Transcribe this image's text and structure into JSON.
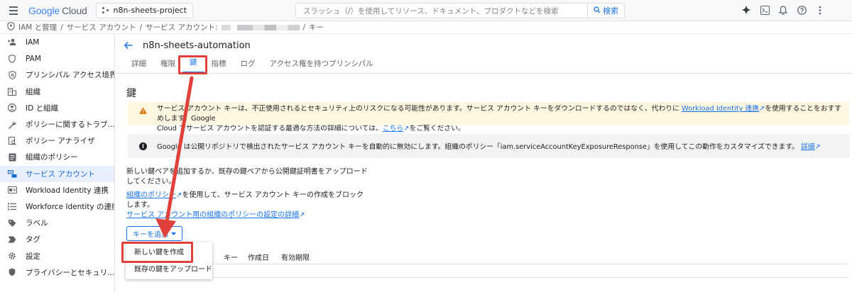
{
  "topbar": {
    "logo_google": "Google",
    "logo_cloud": "Cloud",
    "project": "n8n-sheets-project",
    "search_placeholder": "スラッシュ（/）を使用してリソース、ドキュメント、プロダクトなどを検索",
    "search_button": "検索"
  },
  "breadcrumb": {
    "items": [
      "IAM と管理",
      "サービス アカウント",
      "サービス アカウント:",
      "キー"
    ]
  },
  "sidebar": {
    "items": [
      {
        "label": "IAM",
        "icon": "person-add-icon"
      },
      {
        "label": "PAM",
        "icon": "shield-icon"
      },
      {
        "label": "プリンシパル アクセス境界",
        "icon": "policy-icon"
      },
      {
        "label": "組織",
        "icon": "building-icon"
      },
      {
        "label": "ID と組織",
        "icon": "account-icon"
      },
      {
        "label": "ポリシーに関するトラブ...",
        "icon": "wrench-icon"
      },
      {
        "label": "ポリシー アナライザ",
        "icon": "analyzer-icon"
      },
      {
        "label": "組織のポリシー",
        "icon": "document-icon"
      },
      {
        "label": "サービス アカウント",
        "icon": "service-account-icon"
      },
      {
        "label": "Workload Identity 連携",
        "icon": "id-card-icon"
      },
      {
        "label": "Workforce Identity の連携",
        "icon": "list-icon"
      },
      {
        "label": "ラベル",
        "icon": "label-icon"
      },
      {
        "label": "タグ",
        "icon": "tag-icon"
      },
      {
        "label": "設定",
        "icon": "gear-icon"
      },
      {
        "label": "プライバシーとセキュリ...",
        "icon": "security-icon"
      }
    ],
    "active_index": 8
  },
  "main": {
    "title": "n8n-sheets-automation",
    "tabs": [
      "詳細",
      "権限",
      "鍵",
      "指標",
      "ログ",
      "アクセス権を持つプリンシパル"
    ],
    "active_tab": 2,
    "section_title": "鍵",
    "warning": {
      "line1_a": "サービス アカウント キーは、不正使用されるとセキュリティ上のリスクになる可能性があります。サービス アカウント キーをダウンロードするのではなく、代わりに",
      "line1_link": "Workload Identity 連携",
      "line1_b": "を使用することをおすすめします。Google",
      "line2_a": "Cloud でサービス アカウントを認証する最適な方法の詳細については、",
      "line2_link": "こちら",
      "line2_b": "をご覧ください。"
    },
    "info": {
      "text": "Google は公開リポジトリで検出されたサービス アカウント キーを自動的に無効にします。組織のポリシー「iam.serviceAccountKeyExposureResponse」を使用してこの動作をカスタマイズできます。",
      "link": "詳細"
    },
    "desc1": "新しい鍵ペアを追加するか、既存の鍵ペアから公開鍵証明書をアップロードしてください。",
    "desc2_link": "組織のポリシー",
    "desc2_text": "を使用して、サービス アカウント キーの作成をブロックします。",
    "desc2_link2": "サービス アカウント用の組織のポリシーの設定の詳細",
    "add_key_button": "キーを追加",
    "table_headers": [
      "キー",
      "作成日",
      "有効期限"
    ],
    "menu": [
      "新しい鍵を作成",
      "既存の鍵をアップロード"
    ]
  },
  "colors": {
    "accent": "#1a73e8",
    "annotation_red": "#e0413a",
    "warning_bg": "#fef7e0",
    "active_bg": "#e8f0fe"
  }
}
